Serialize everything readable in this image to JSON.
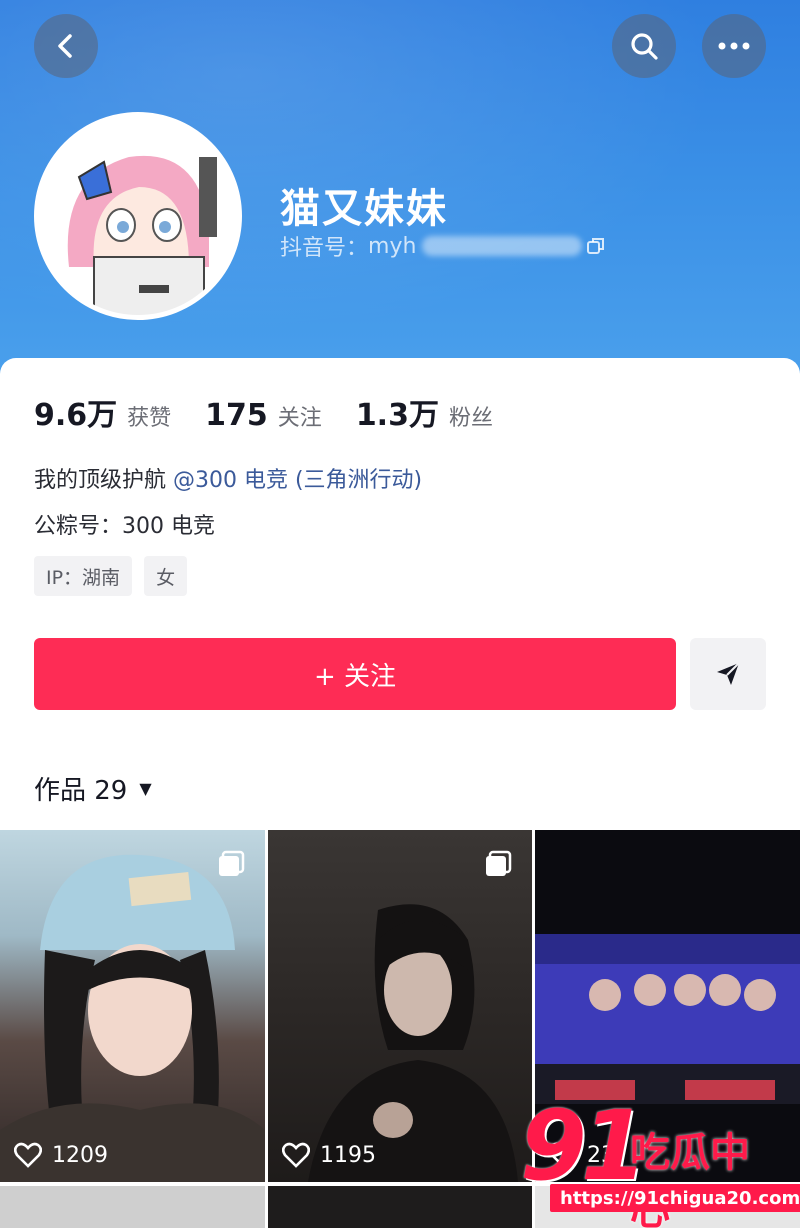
{
  "profile": {
    "nickname": "猫又妹妹",
    "douyin_id_label": "抖音号：",
    "douyin_id_visible": "myh"
  },
  "stats": [
    {
      "value": "9.6万",
      "label": "获赞"
    },
    {
      "value": "175",
      "label": "关注"
    },
    {
      "value": "1.3万",
      "label": "粉丝"
    }
  ],
  "bio": {
    "line1_prefix": "我的顶级护航 ",
    "line1_mention": "@300 电竞 (三角洲行动)",
    "line2": "公粽号：300 电竞"
  },
  "tags": [
    "IP：湖南",
    "女"
  ],
  "actions": {
    "follow_label": "+ 关注"
  },
  "works": {
    "tab_label": "作品 29",
    "items": [
      {
        "likes": "1209"
      },
      {
        "likes": "1195"
      },
      {
        "likes": "23"
      }
    ]
  },
  "watermark": {
    "number": "91",
    "name": "吃瓜中心",
    "url": "https://91chigua20.com"
  },
  "colors": {
    "accent": "#fe2c55",
    "header": "#3a8fe6"
  }
}
